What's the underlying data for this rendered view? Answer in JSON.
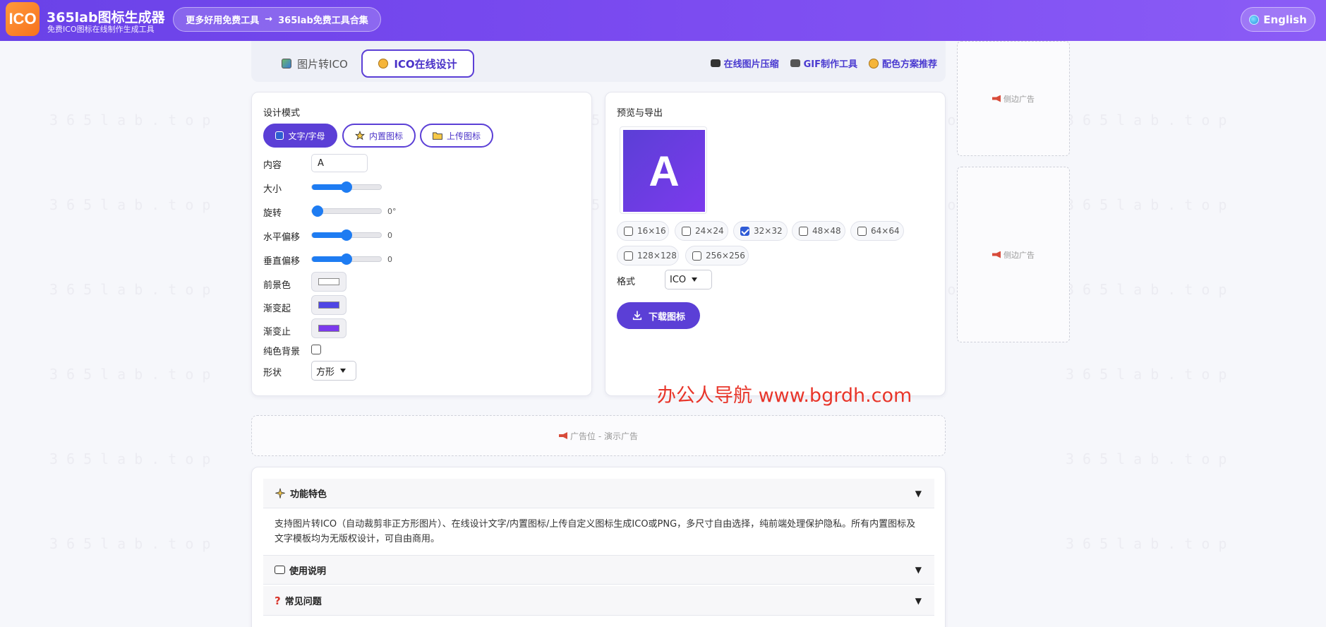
{
  "header": {
    "logo_text": "ICO",
    "title": "365lab图标生成器",
    "subtitle": "免费ICO图标在线制作生成工具",
    "more_tools_left": "更多好用免费工具",
    "more_tools_arrow": "→",
    "more_tools_right": "365lab免费工具合集",
    "language": "English"
  },
  "tabs": {
    "image_to_ico": "图片转ICO",
    "ico_design": "ICO在线设计",
    "links": [
      "在线图片压缩",
      "GIF制作工具",
      "配色方案推荐"
    ]
  },
  "design": {
    "title": "设计模式",
    "modes": [
      "文字/字母",
      "内置图标",
      "上传图标"
    ],
    "content_label": "内容",
    "content_value": "A",
    "size_label": "大小",
    "size_level_percent": 50,
    "rotate_label": "旋转",
    "rotate_value": "0°",
    "rotate_level_percent": 0,
    "hshift_label": "水平偏移",
    "hshift_value": "0",
    "hshift_level_percent": 50,
    "vshift_label": "垂直偏移",
    "vshift_value": "0",
    "vshift_level_percent": 50,
    "fg_label": "前景色",
    "fg_color": "#ffffff",
    "grad_start_label": "渐变起",
    "grad_start_color": "#4f46e5",
    "grad_end_label": "渐变止",
    "grad_end_color": "#7c3aed",
    "solid_bg_label": "纯色背景",
    "solid_bg_checked": false,
    "shape_label": "形状",
    "shape_value": "方形"
  },
  "preview": {
    "title": "预览与导出",
    "icon_letter": "A",
    "sizes": [
      {
        "label": "16×16",
        "checked": false
      },
      {
        "label": "24×24",
        "checked": false
      },
      {
        "label": "32×32",
        "checked": true
      },
      {
        "label": "48×48",
        "checked": false
      },
      {
        "label": "64×64",
        "checked": false
      },
      {
        "label": "128×128",
        "checked": false
      },
      {
        "label": "256×256",
        "checked": false
      }
    ],
    "format_label": "格式",
    "format_value": "ICO",
    "download_label": "下载图标"
  },
  "ads": {
    "side": "侧边广告",
    "bottom": "广告位 - 演示广告"
  },
  "overlay_text": "办公人导航 www.bgrdh.com",
  "faq": {
    "features_title": "功能特色",
    "features_body": "支持图片转ICO（自动裁剪非正方形图片）、在线设计文字/内置图标/上传自定义图标生成ICO或PNG，多尺寸自由选择，纯前端处理保护隐私。所有内置图标及文字模板均为无版权设计，可自由商用。",
    "usage_title": "使用说明",
    "qa_title": "常见问题",
    "toggle": "▼"
  },
  "watermark": "365lab.top",
  "colors": {
    "brand": "#6a42e8",
    "accent": "#5b3fd6",
    "slider": "#1e7cf2",
    "overlay": "#e8352a"
  }
}
